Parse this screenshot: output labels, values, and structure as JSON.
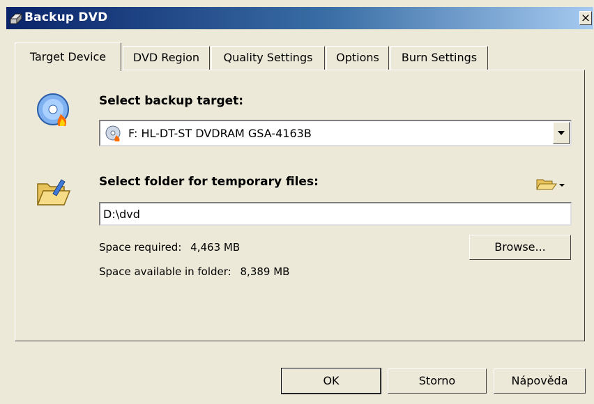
{
  "window": {
    "title": "Backup DVD",
    "close_label": "×"
  },
  "tabs": [
    {
      "label": "Target Device",
      "active": true
    },
    {
      "label": "DVD Region"
    },
    {
      "label": "Quality Settings"
    },
    {
      "label": "Options"
    },
    {
      "label": "Burn Settings"
    }
  ],
  "target": {
    "heading": "Select backup target:",
    "selected_device": "F: HL-DT-ST DVDRAM GSA-4163B"
  },
  "temp": {
    "heading": "Select folder for temporary files:",
    "folder_value": "D:\\dvd",
    "space_required_label": "Space required:",
    "space_required_value": "4,463 MB",
    "space_available_label": "Space available in folder:",
    "space_available_value": "8,389 MB",
    "browse_label": "Browse..."
  },
  "footer": {
    "ok_label": "OK",
    "cancel_label": "Storno",
    "help_label": "Nápověda"
  },
  "icons": {
    "title": "dvd-backup-icon",
    "target": "disc-burn-icon",
    "folder": "folder-open-icon",
    "folder_menu": "folder-dropdown-icon",
    "drive": "optical-drive-icon"
  },
  "colors": {
    "titlebar_start": "#0a246a",
    "titlebar_end": "#a6caf0",
    "window_bg": "#ece9d8"
  }
}
